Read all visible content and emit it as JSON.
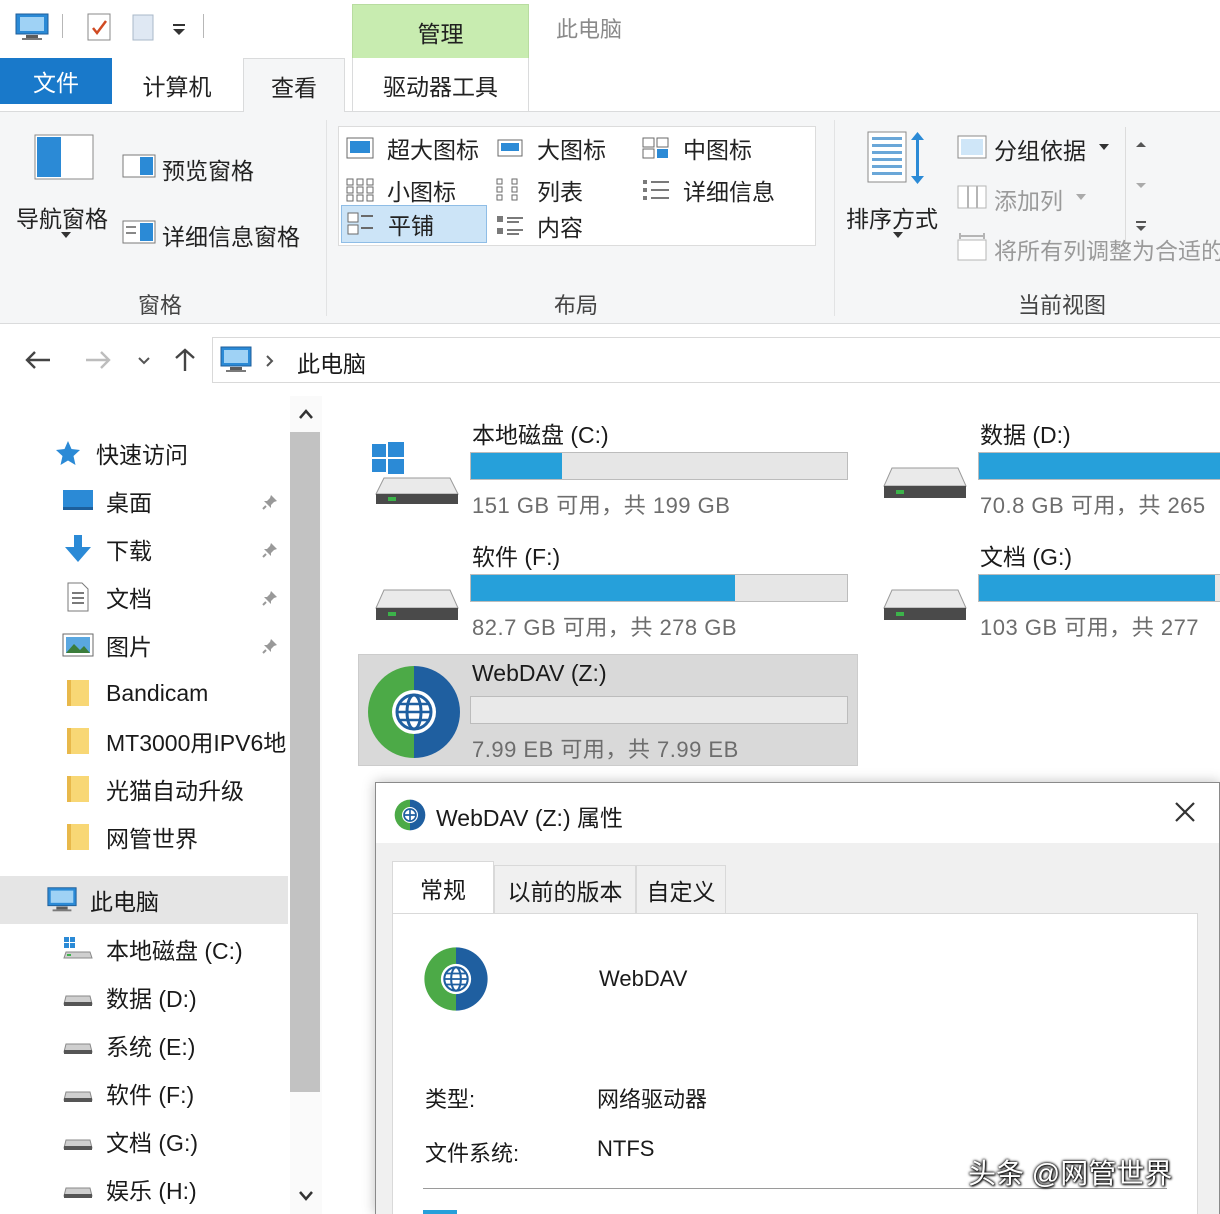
{
  "window": {
    "title": "此电脑",
    "context_tab": "管理"
  },
  "ribbon": {
    "tabs": {
      "file": "文件",
      "computer": "计算机",
      "view": "查看",
      "drive_tools": "驱动器工具"
    },
    "panes": {
      "label": "窗格",
      "navigation_pane": "导航窗格",
      "preview_pane": "预览窗格",
      "details_pane": "详细信息窗格"
    },
    "layout": {
      "label": "布局",
      "extra_large": "超大图标",
      "large": "大图标",
      "medium": "中图标",
      "small": "小图标",
      "list": "列表",
      "details": "详细信息",
      "tiles": "平铺",
      "content": "内容"
    },
    "current_view": {
      "label": "当前视图",
      "sort_by": "排序方式",
      "group_by": "分组依据",
      "add_columns": "添加列",
      "size_all_columns": "将所有列调整为合适的"
    }
  },
  "address": {
    "path": "此电脑"
  },
  "sidebar": {
    "quick_access": "快速访问",
    "items": [
      "桌面",
      "下载",
      "文档",
      "图片",
      "Bandicam",
      "MT3000用IPV6地",
      "光猫自动升级",
      "网管世界"
    ],
    "this_pc": "此电脑",
    "drives": [
      "本地磁盘 (C:)",
      "数据 (D:)",
      "系统 (E:)",
      "软件 (F:)",
      "文档 (G:)",
      "娱乐 (H:)"
    ]
  },
  "drives": [
    {
      "name": "本地磁盘 (C:)",
      "free_text": "151 GB 可用，共 199 GB",
      "used_fraction": 0.241
    },
    {
      "name": "数据 (D:)",
      "free_text": "70.8 GB 可用，共 265",
      "used_fraction": 0.733
    },
    {
      "name": "软件 (F:)",
      "free_text": "82.7 GB 可用，共 278 GB",
      "used_fraction": 0.703
    },
    {
      "name": "文档 (G:)",
      "free_text": "103 GB 可用，共 277",
      "used_fraction": 0.628
    },
    {
      "name": "WebDAV (Z:)",
      "free_text": "7.99 EB 可用，共 7.99 EB",
      "used_fraction": 0.0
    }
  ],
  "dialog": {
    "title": "WebDAV (Z:) 属性",
    "tabs": [
      "常规",
      "以前的版本",
      "自定义"
    ],
    "drive_label": "WebDAV",
    "type_label": "类型:",
    "type_value": "网络驱动器",
    "fs_label": "文件系统:",
    "fs_value": "NTFS"
  },
  "watermark": "头条 @网管世界",
  "colors": {
    "accent": "#1979ca",
    "bar_fill": "#26a0da",
    "manage_tab": "#c8ecb0"
  }
}
